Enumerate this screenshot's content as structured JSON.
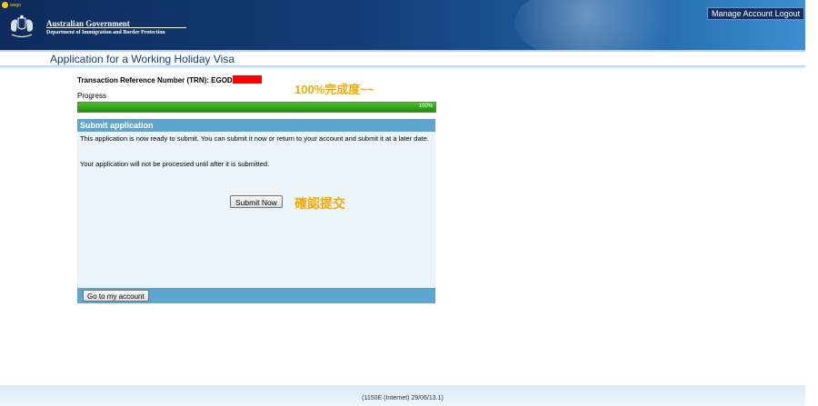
{
  "header": {
    "brand_small": "wego",
    "gov_title": "Australian Government",
    "gov_dept": "Department of Immigration and Border Protection",
    "manage_account": "Manage Account",
    "logout": "Logout"
  },
  "page": {
    "title": "Application for a Working Holiday Visa"
  },
  "trn": {
    "label": "Transaction Reference Number (TRN): EGOD"
  },
  "annotations": {
    "progress_note": "100%完成度~~",
    "submit_note": "確認提交"
  },
  "progress": {
    "label": "Progress",
    "value_text": "100%",
    "fraction": 1.0,
    "color": "#2a9a1b"
  },
  "panel": {
    "heading": "Submit application",
    "message_1": "This application is now ready to submit. You can submit it now or return to your account and submit it at a later date.",
    "message_2": "Your application will not be processed until after it is submitted.",
    "submit_button": "Submit Now",
    "account_button": "Go to my account"
  },
  "footer": {
    "version": "(1150E (Internet) 29/06/13.1)"
  },
  "colors": {
    "header_dark": "#0d2b5c",
    "panel_bar": "#5ea5d1",
    "panel_bg": "#ebf3fb",
    "annotation": "#f2a900",
    "redaction": "#ff0000"
  }
}
